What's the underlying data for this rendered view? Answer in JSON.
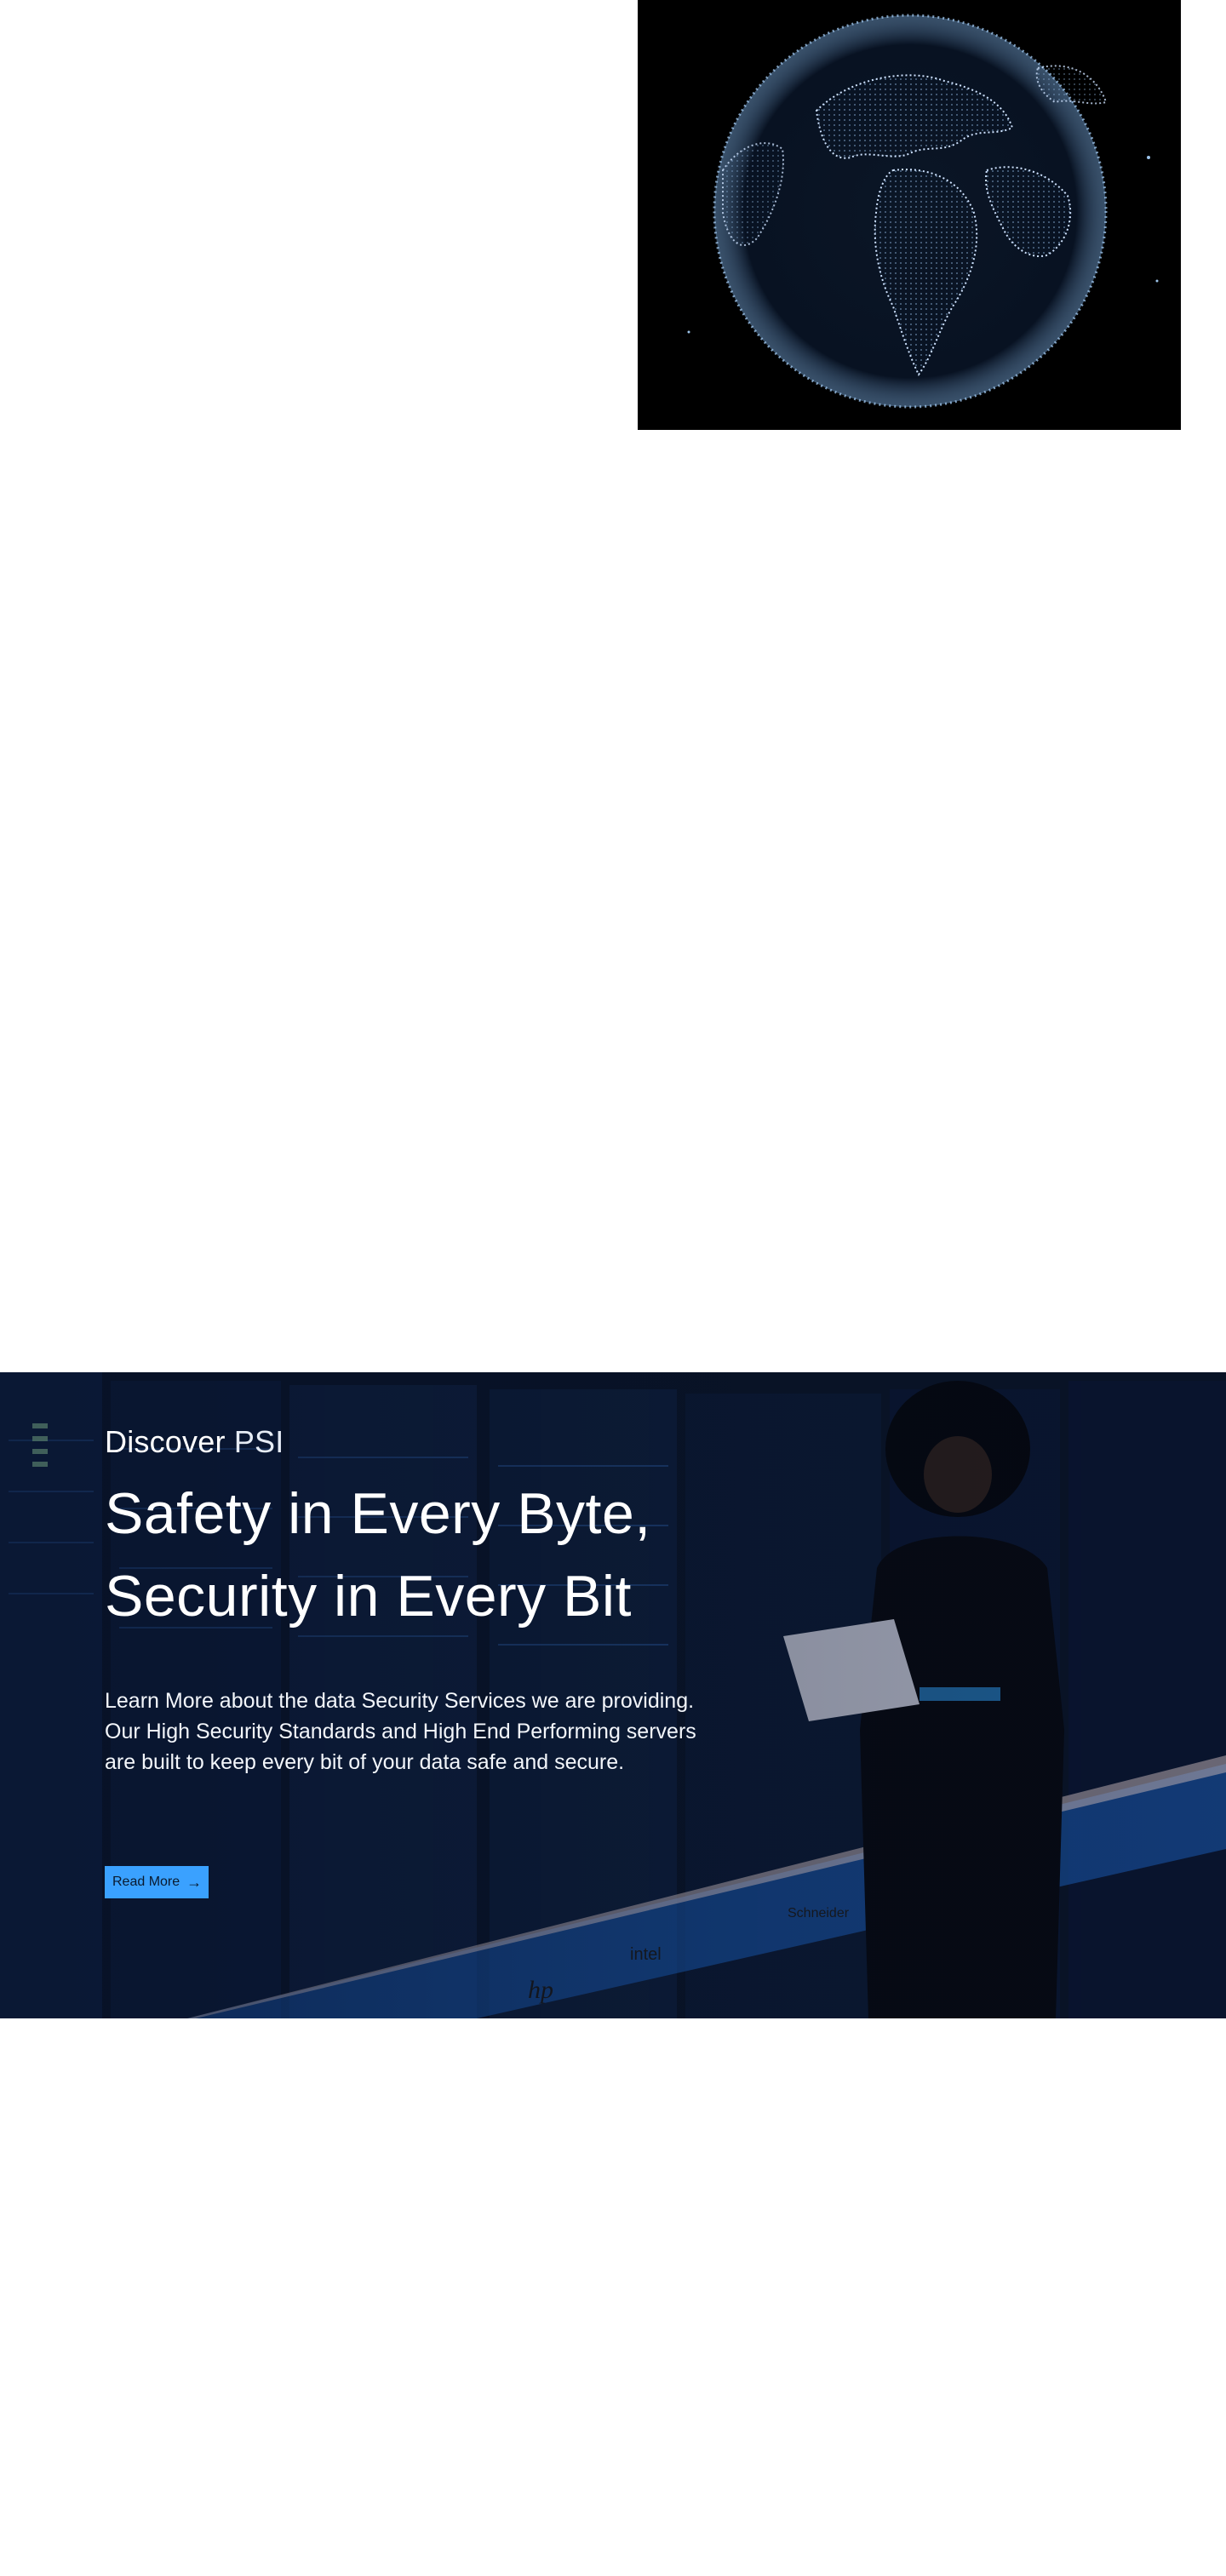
{
  "hero": {
    "eyebrow_strong": "Discover",
    "eyebrow_light": "PSI",
    "headline_line1": "Safety in Every Byte,",
    "headline_line2": "Security in Every Bit",
    "body": "Learn More about the data Security Services we are providing. Our High Security Standards and High End Performing servers are built to keep every bit of your data safe and secure.",
    "cta_label": "Read More",
    "cta_icon": "arrow-right-icon",
    "cta_color": "#3aa1ff"
  },
  "logos": [
    "hp",
    "intel",
    "Schneider"
  ]
}
